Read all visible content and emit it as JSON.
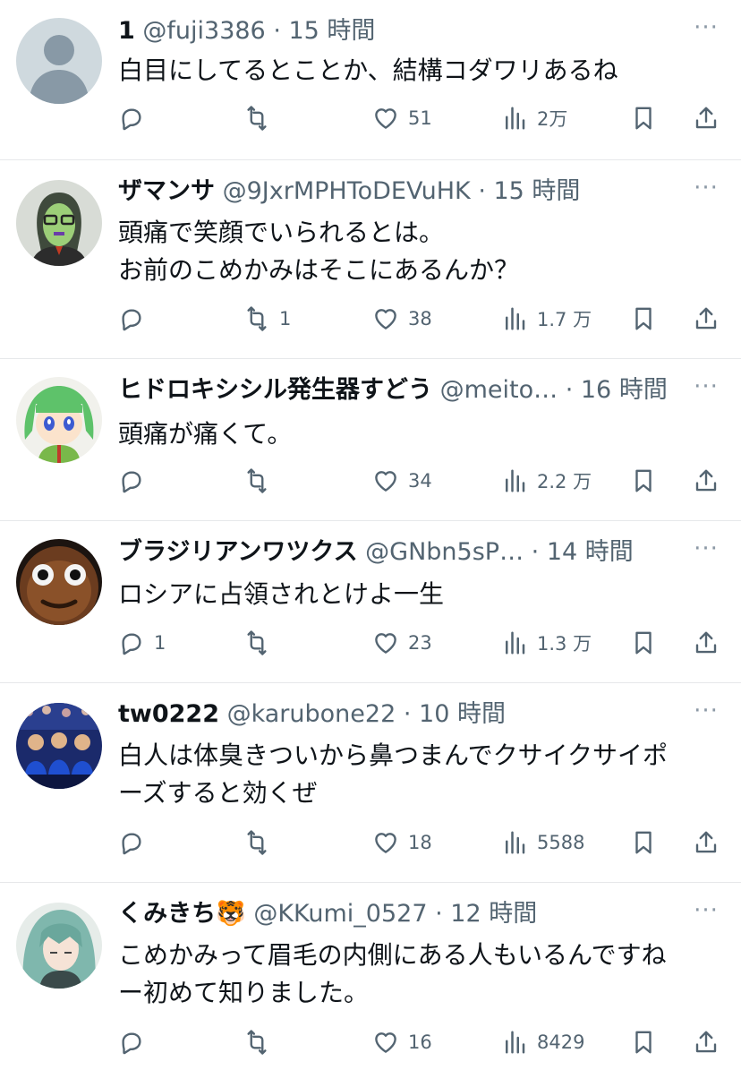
{
  "replies": [
    {
      "name": "1",
      "emoji": "",
      "handle": "@fuji3386",
      "time": "15 時間",
      "text": [
        "白目にしてるとことか、結構コダワリあるね"
      ],
      "reply_count": "",
      "retweet_count": "",
      "like_count": "51",
      "view_count": "2万",
      "avatar": "default-avatar"
    },
    {
      "name": "ザマンサ",
      "emoji": "",
      "handle": "@9JxrMPHToDEVuHK",
      "time": "15 時間",
      "text": [
        "頭痛で笑顔でいられるとは。",
        "お前のこめかみはそこにあるんか？"
      ],
      "reply_count": "",
      "retweet_count": "1",
      "like_count": "38",
      "view_count": "1.7 万",
      "avatar": "glasses-man-avatar"
    },
    {
      "name": "ヒドロキシシル発生器すどう",
      "emoji": "",
      "handle": "@meito…",
      "time": "16 時間",
      "text": [
        "頭痛が痛くて。"
      ],
      "reply_count": "",
      "retweet_count": "",
      "like_count": "34",
      "view_count": "2.2 万",
      "avatar": "green-hair-anime-avatar"
    },
    {
      "name": "ブラジリアンワツクス",
      "emoji": "",
      "handle": "@GNbn5sP…",
      "time": "14 時間",
      "text": [
        "ロシアに占領されとけよ一生"
      ],
      "reply_count": "1",
      "retweet_count": "",
      "like_count": "23",
      "view_count": "1.3 万",
      "avatar": "dark-face-avatar"
    },
    {
      "name": "tw0222",
      "emoji": "",
      "handle": "@karubone22",
      "time": "10 時間",
      "text": [
        "白人は体臭きついから鼻つまんでクサイクサイポ",
        "ーズすると効くぜ"
      ],
      "reply_count": "",
      "retweet_count": "",
      "like_count": "18",
      "view_count": "5588",
      "avatar": "team-photo-avatar"
    },
    {
      "name": "くみきち",
      "emoji": "🐯",
      "handle": "@KKumi_0527",
      "time": "12 時間",
      "text": [
        "こめかみって眉毛の内側にある人もいるんですね",
        "ー初めて知りました。"
      ],
      "reply_count": "",
      "retweet_count": "",
      "like_count": "16",
      "view_count": "8429",
      "avatar": "teal-hair-anime-avatar"
    }
  ],
  "colors": {
    "text": "#0f1419",
    "muted": "#536471",
    "divider": "#e6e8ea"
  }
}
